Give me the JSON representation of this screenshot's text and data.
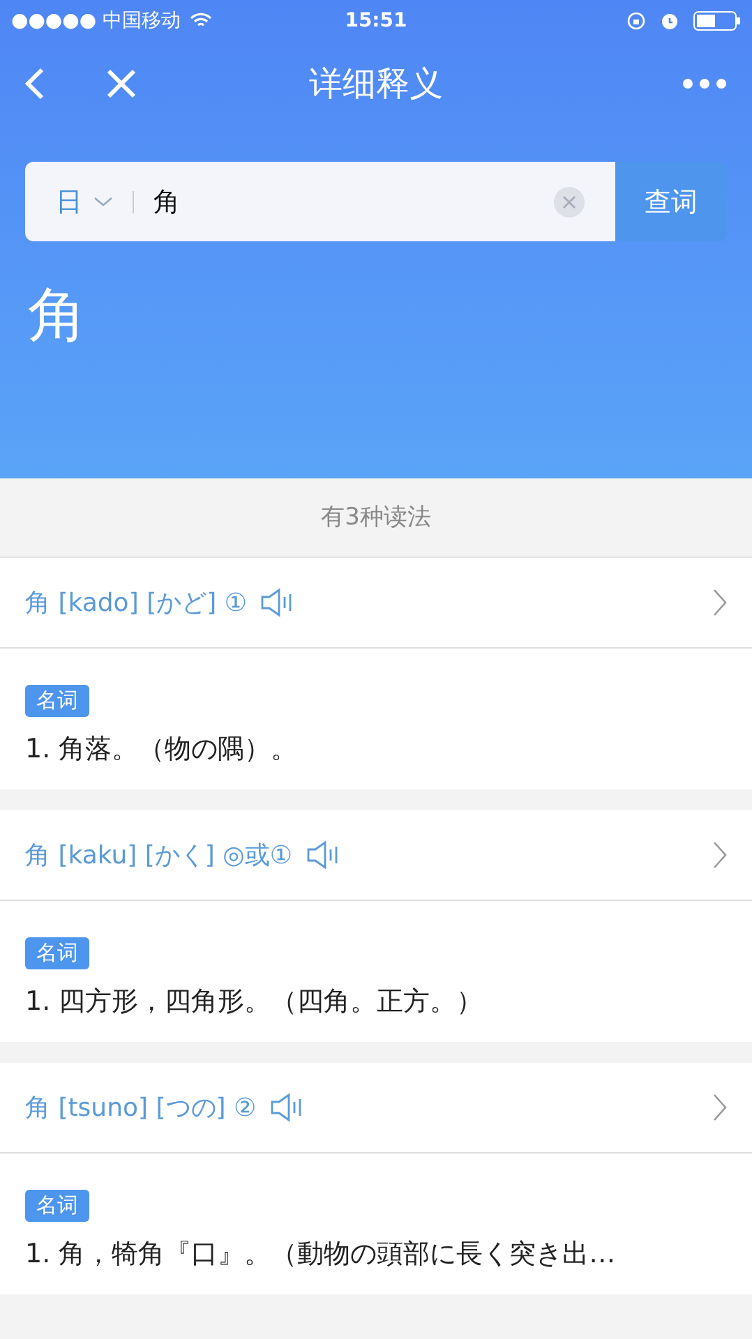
{
  "status_bar": {
    "carrier": "●●●●● 中国移动",
    "time": "15:51"
  },
  "nav": {
    "title": "详细释义"
  },
  "search": {
    "language": "日",
    "value": "角",
    "button": "查词"
  },
  "headword": "角",
  "count_label": "有3种读法",
  "readings": [
    {
      "heading": "角 [kado] [かど] ①",
      "pos": "名词",
      "definition": "1. 角落。（物の隅）。"
    },
    {
      "heading": "角 [kaku] [かく] ◎或①",
      "pos": "名词",
      "definition": "1. 四方形，四角形。（四角。正方。）"
    },
    {
      "heading": "角 [tsuno] [つの] ②",
      "pos": "名词",
      "definition": "1. 角，犄角『口』。（動物の頭部に長く突き出…"
    }
  ]
}
